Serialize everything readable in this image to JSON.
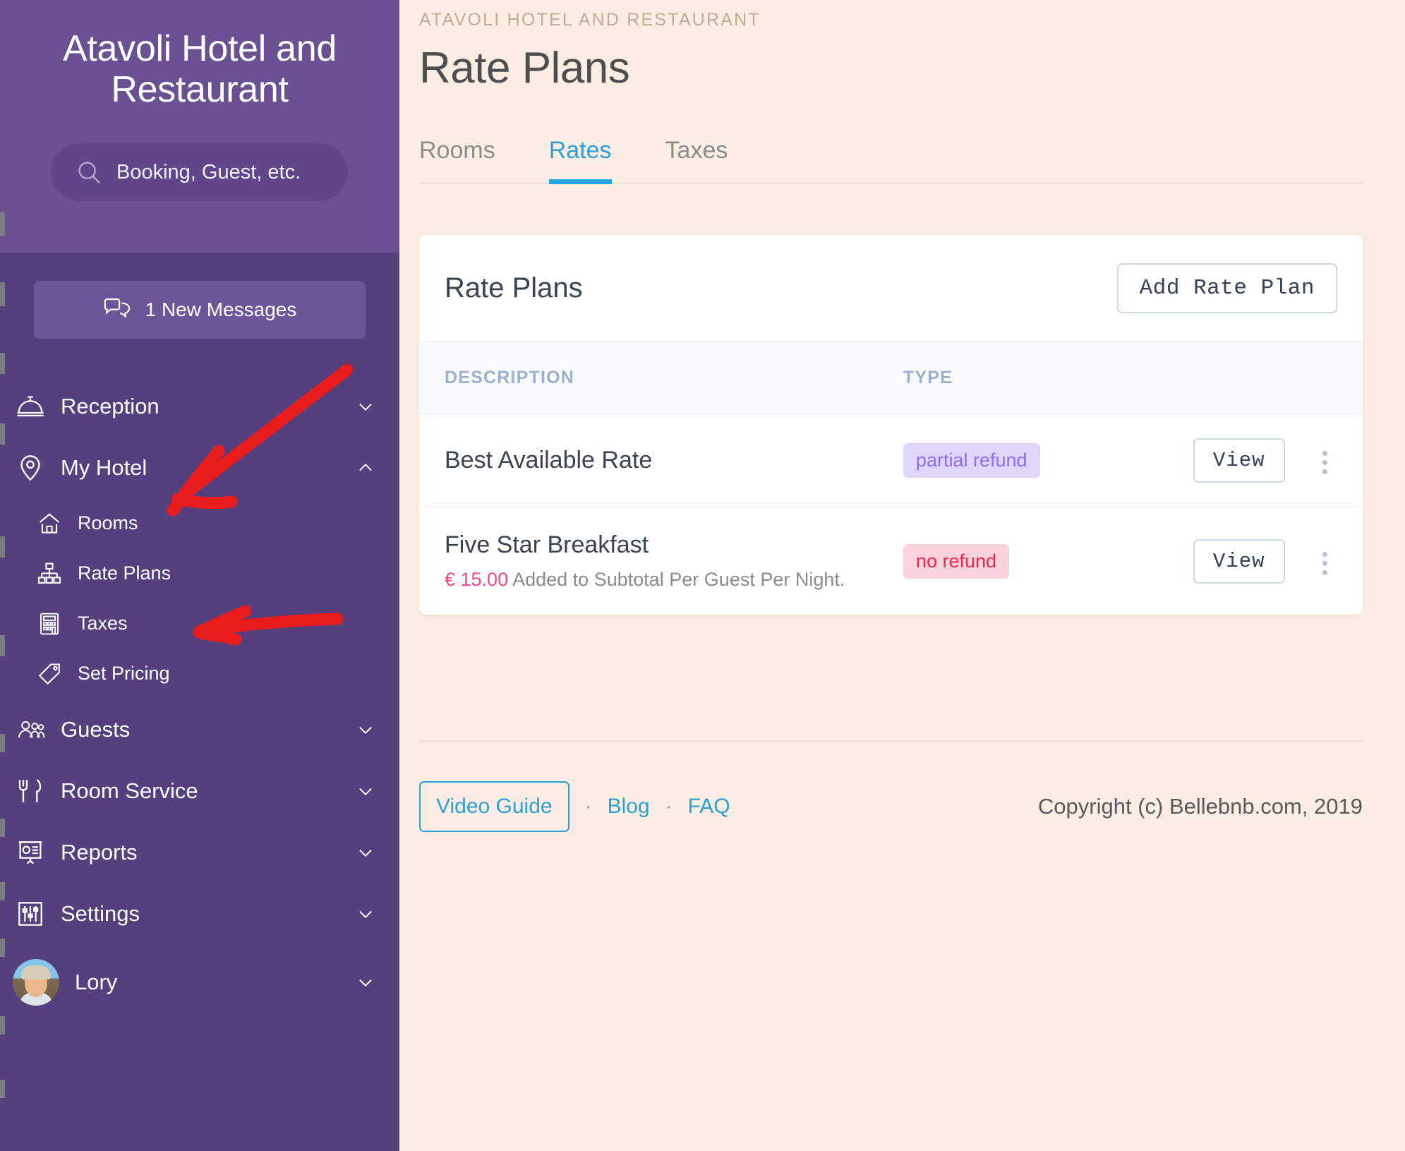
{
  "sidebar": {
    "brand": "Atavoli Hotel and Restaurant",
    "search": {
      "placeholder": "Booking, Guest, etc.",
      "icon": "search-icon"
    },
    "messages": {
      "label": "1 New Messages",
      "icon": "chat-bubbles-icon",
      "count": 1
    },
    "nav": [
      {
        "label": "Reception",
        "icon": "service-bell-icon",
        "chevron": "chevron-down",
        "expanded": false
      },
      {
        "label": "My Hotel",
        "icon": "map-pin-icon",
        "chevron": "chevron-up",
        "expanded": true
      },
      {
        "label": "Guests",
        "icon": "people-icon",
        "chevron": "chevron-down",
        "expanded": false
      },
      {
        "label": "Room Service",
        "icon": "fork-knife-icon",
        "chevron": "chevron-down",
        "expanded": false
      },
      {
        "label": "Reports",
        "icon": "presentation-chart-icon",
        "chevron": "chevron-down",
        "expanded": false
      },
      {
        "label": "Settings",
        "icon": "sliders-icon",
        "chevron": "chevron-down",
        "expanded": false
      }
    ],
    "sub_nav": [
      {
        "label": "Rooms",
        "icon": "house-icon"
      },
      {
        "label": "Rate Plans",
        "icon": "hierarchy-icon"
      },
      {
        "label": "Taxes",
        "icon": "calculator-icon"
      },
      {
        "label": "Set Pricing",
        "icon": "price-tag-icon"
      }
    ],
    "profile": {
      "name": "Lory",
      "avatar": "user-avatar",
      "chevron": "chevron-down"
    },
    "colors": {
      "top_bg": "#6a5191",
      "bg": "#553f7d",
      "search_bg": "#60478a",
      "msg_bg": "#6d5697"
    }
  },
  "header": {
    "eyebrow": "ATAVOLI HOTEL AND RESTAURANT",
    "title": "Rate Plans",
    "tabs": [
      {
        "label": "Rooms",
        "active": false
      },
      {
        "label": "Rates",
        "active": true
      },
      {
        "label": "Taxes",
        "active": false
      }
    ],
    "accent": "#26a5dd"
  },
  "card": {
    "title": "Rate Plans",
    "add_button": "Add Rate Plan",
    "columns": [
      "DESCRIPTION",
      "TYPE",
      ""
    ],
    "rows": [
      {
        "name": "Best Available Rate",
        "sub_price": "",
        "sub_text": "",
        "type": "partial refund",
        "type_style": "partial",
        "action": "View",
        "menu": "kebab-menu-icon"
      },
      {
        "name": "Five Star Breakfast",
        "sub_price": "€ 15.00",
        "sub_text": "Added to Subtotal Per Guest Per Night.",
        "type": "no refund",
        "type_style": "norefund",
        "action": "View",
        "menu": "kebab-menu-icon"
      }
    ],
    "badge_colors": {
      "partial_bg": "#e0d6fd",
      "partial_fg": "#8b6df2",
      "norefund_bg": "#fbd3dc",
      "norefund_fg": "#f0284f"
    }
  },
  "footer": {
    "video_guide": "Video Guide",
    "sep1": "·",
    "blog": "Blog",
    "sep2": "·",
    "faq": "FAQ",
    "copyright": "Copyright (c) Bellebnb.com, 2019"
  },
  "annotations": {
    "arrow_color": "#e81c1c",
    "arrows": [
      {
        "name": "arrow-to-my-hotel",
        "points": "to My Hotel menu item"
      },
      {
        "name": "arrow-to-rate-plans",
        "points": "to Rate Plans submenu item"
      }
    ]
  }
}
